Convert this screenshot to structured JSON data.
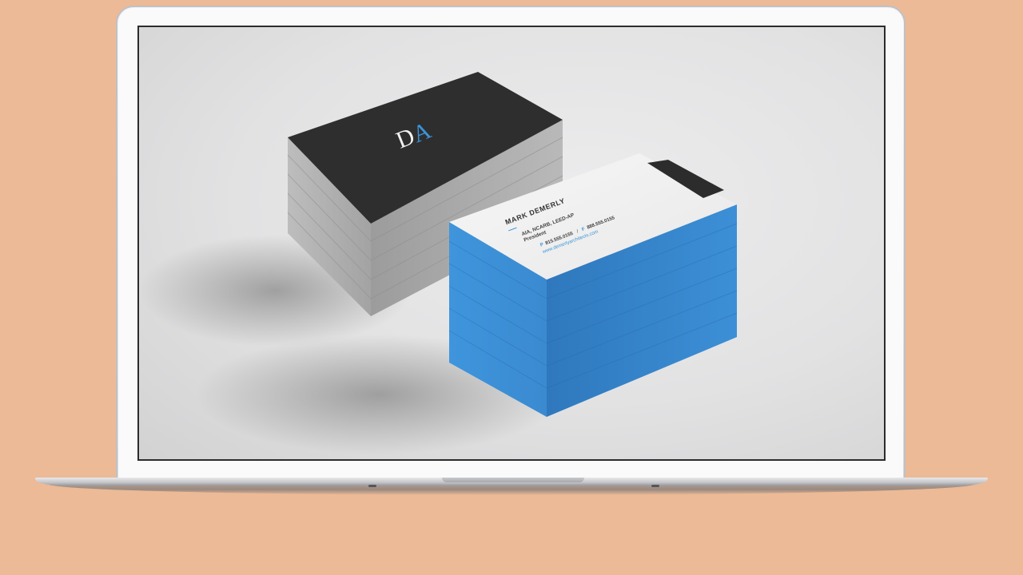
{
  "card_back": {
    "monogram_d": "D",
    "monogram_a": "A",
    "colors": {
      "card": "#2e2e2f",
      "edges": "#a9a9aa",
      "accent": "#3b94d9"
    }
  },
  "card_front": {
    "name": "MARK DEMERLY",
    "credentials": "AIA, NCARB, LEED-AP",
    "title": "President",
    "phone_label": "P",
    "phone": "815.555.0155",
    "fax_label": "F",
    "fax": "888.555.0155",
    "website": "www.demerlyarchitects.com",
    "colors": {
      "card": "#f3f3f3",
      "edges": "#3d8fd6",
      "bar": "#2c2c2c"
    }
  },
  "colors": {
    "background": "#ecba96",
    "laptop": "#d9dadd",
    "screen_frame": "#2c2c2c"
  }
}
